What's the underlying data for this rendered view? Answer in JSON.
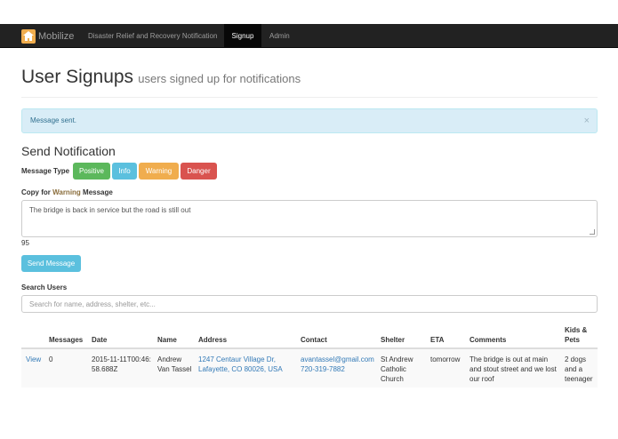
{
  "nav": {
    "brand": "Mobilize",
    "links": [
      "Disaster Relief and Recovery Notification",
      "Signup",
      "Admin"
    ]
  },
  "page": {
    "title": "User Signups",
    "subtitle": "users signed up for notifications"
  },
  "alert": {
    "text": "Message sent.",
    "close": "×"
  },
  "notify": {
    "heading": "Send Notification",
    "message_type_label": "Message Type",
    "types": [
      "Positive",
      "Info",
      "Warning",
      "Danger"
    ],
    "copy_prefix": "Copy for ",
    "copy_type": "Warning",
    "copy_suffix": " Message",
    "message_text": "The bridge is back in service but the road is still out",
    "chars_remaining": "95",
    "send_label": "Send Message"
  },
  "search": {
    "label": "Search Users",
    "placeholder": "Search for name, address, shelter, etc..."
  },
  "table": {
    "headers": [
      "",
      "Messages",
      "Date",
      "Name",
      "Address",
      "Contact",
      "Shelter",
      "ETA",
      "Comments",
      "Kids & Pets"
    ],
    "rows": [
      {
        "action": "View",
        "messages": "0",
        "date": "2015-11-11T00:46:58.688Z",
        "name": "Andrew Van Tassel",
        "address": "1247 Centaur Village Dr, Lafayette, CO 80026, USA",
        "email": "avantassel@gmail.com",
        "phone": "720-319-7882",
        "shelter": "St Andrew Catholic Church",
        "eta": "tomorrow",
        "comments": "The bridge is out at main and stout street and we lost our roof",
        "kids_pets": "2 dogs and a teenager"
      }
    ]
  },
  "colors": {
    "navbar": "#222222",
    "positive": "#5cb85c",
    "info": "#5bc0de",
    "warning": "#f0ad4e",
    "danger": "#d9534f",
    "link": "#337ab7"
  }
}
